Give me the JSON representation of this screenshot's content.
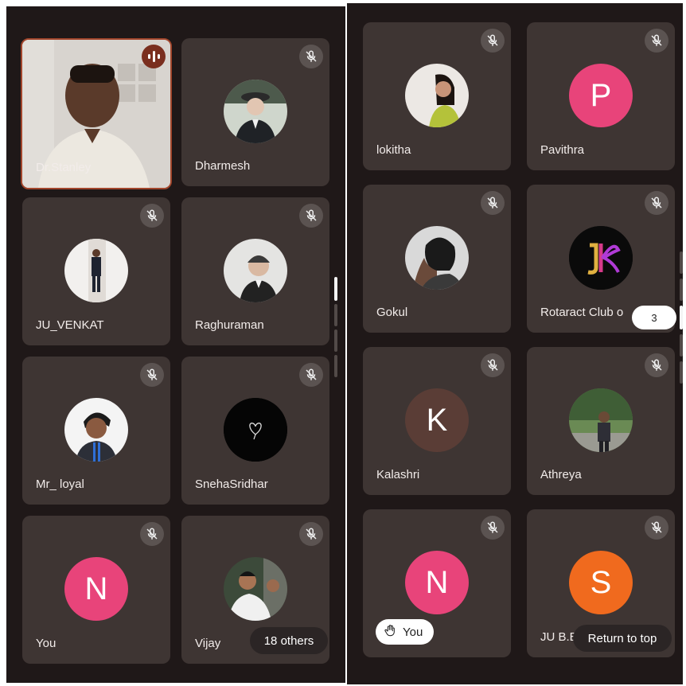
{
  "left_panel": {
    "tiles": [
      {
        "name": "Dr.Stanley",
        "type": "video",
        "speaking": true
      },
      {
        "name": "Dharmesh",
        "type": "photo"
      },
      {
        "name": "JU_VENKAT",
        "type": "photo"
      },
      {
        "name": "Raghuraman",
        "type": "photo"
      },
      {
        "name": "Mr_ loyal",
        "type": "photo"
      },
      {
        "name": "SnehaSridhar",
        "type": "photo"
      },
      {
        "name": "You",
        "type": "letter",
        "letter": "N",
        "color": "#e8447a"
      },
      {
        "name": "Vijay",
        "type": "photo"
      }
    ],
    "others_label": "18 others"
  },
  "right_panel": {
    "tiles": [
      {
        "name": "lokitha",
        "type": "photo"
      },
      {
        "name": "Pavithra",
        "type": "letter",
        "letter": "P",
        "color": "#e8447a"
      },
      {
        "name": "Gokul",
        "type": "photo"
      },
      {
        "name": "Rotaract Club o",
        "type": "logo"
      },
      {
        "name": "Kalashri",
        "type": "letter",
        "letter": "K",
        "color": "#5a3d36"
      },
      {
        "name": "Athreya",
        "type": "photo"
      },
      {
        "name": "",
        "type": "letter",
        "letter": "N",
        "color": "#e8447a",
        "hand_raised_label": "You"
      },
      {
        "name": "JU B.E",
        "type": "letter",
        "letter": "S",
        "color": "#f06a1e"
      }
    ],
    "page_badge": "3",
    "return_label": "Return to top"
  },
  "icons": {
    "mute": "mic-off-icon",
    "speaking": "audio-wave-icon",
    "hand": "raised-hand-icon"
  }
}
